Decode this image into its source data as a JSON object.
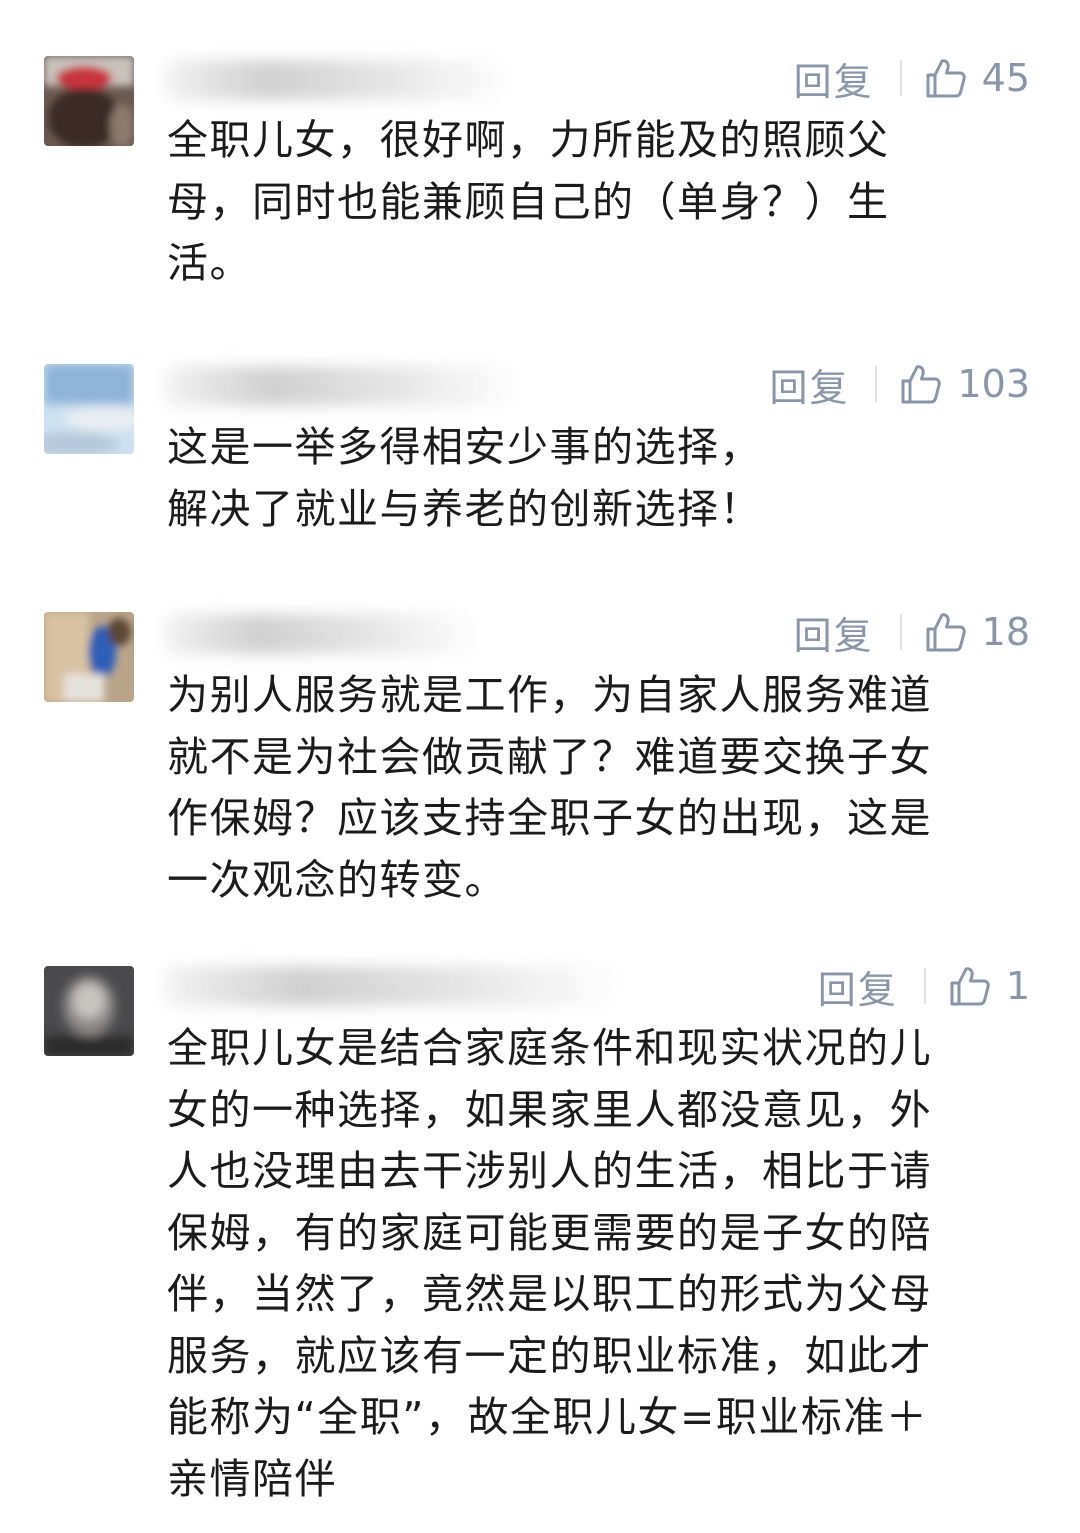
{
  "comments": [
    {
      "reply_label": "回复",
      "like_count": "45",
      "like_icon": "thumbs-up-icon",
      "text": "全职儿女，很好啊，力所能及的照顾父\n母，同时也能兼顾自己的（单身？）生\n活。"
    },
    {
      "reply_label": "回复",
      "like_count": "103",
      "like_icon": "thumbs-up-icon",
      "text": "这是一举多得相安少事的选择，\n解决了就业与养老的创新选择！"
    },
    {
      "reply_label": "回复",
      "like_count": "18",
      "like_icon": "thumbs-up-icon",
      "text": "为别人服务就是工作，为自家人服务难道\n就不是为社会做贡献了？难道要交换子女\n作保姆？应该支持全职子女的出现，这是\n一次观念的转变。"
    },
    {
      "reply_label": "回复",
      "like_count": "1",
      "like_icon": "thumbs-up-icon",
      "text": "全职儿女是结合家庭条件和现实状况的儿\n女的一种选择，如果家里人都没意见，外\n人也没理由去干涉别人的生活，相比于请\n保姆，有的家庭可能更需要的是子女的陪\n伴，当然了，竟然是以职工的形式为父母\n服务，就应该有一定的职业标准，如此才\n能称为“全职”，故全职儿女=职业标准＋\n亲情陪伴"
    }
  ],
  "colors": {
    "meta": "#8a96a8",
    "text": "#1b1b1b",
    "background": "#ffffff"
  }
}
